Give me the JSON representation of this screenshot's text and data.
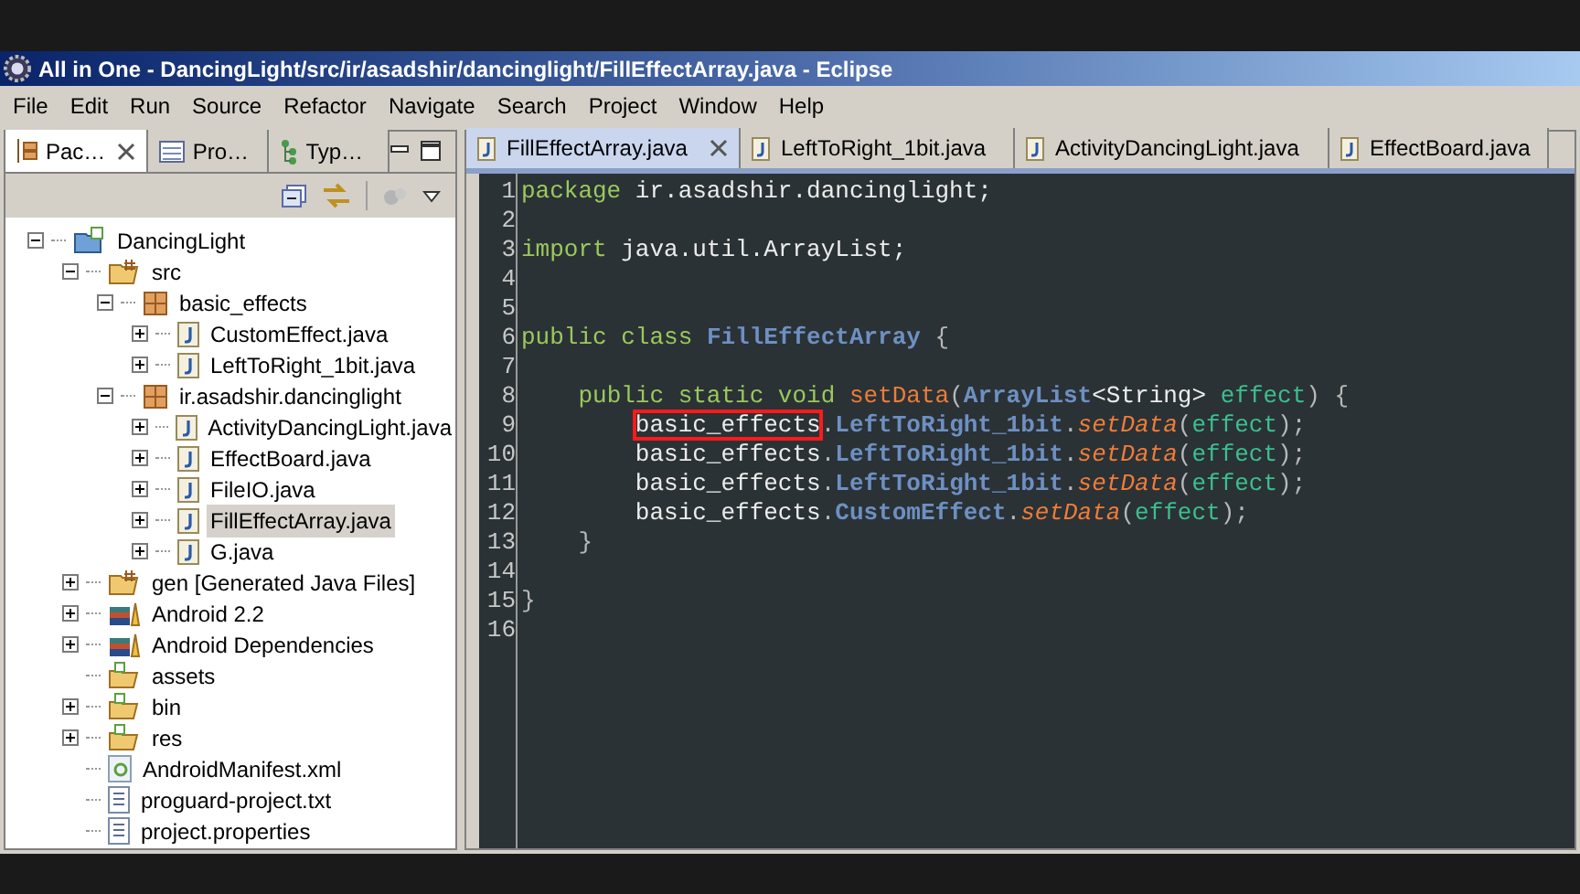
{
  "window": {
    "title": "All in One - DancingLight/src/ir/asadshir/dancinglight/FillEffectArray.java - Eclipse"
  },
  "menu": [
    "File",
    "Edit",
    "Run",
    "Source",
    "Refactor",
    "Navigate",
    "Search",
    "Project",
    "Window",
    "Help"
  ],
  "left_tabs": [
    {
      "label": "Pac…",
      "kind": "package",
      "selected": true
    },
    {
      "label": "Pro…",
      "kind": "problems",
      "selected": false
    },
    {
      "label": "Typ…",
      "kind": "hierarchy",
      "selected": false
    }
  ],
  "tree": [
    {
      "label": "DancingLight",
      "kind": "project",
      "expanded": true,
      "selected": false,
      "children": [
        {
          "label": "src",
          "kind": "srcfolder",
          "expanded": true,
          "selected": false,
          "children": [
            {
              "label": "basic_effects",
              "kind": "package",
              "expanded": true,
              "selected": false,
              "children": [
                {
                  "label": "CustomEffect.java",
                  "kind": "java",
                  "expanded": false,
                  "selected": false
                },
                {
                  "label": "LeftToRight_1bit.java",
                  "kind": "java",
                  "expanded": false,
                  "selected": false
                }
              ]
            },
            {
              "label": "ir.asadshir.dancinglight",
              "kind": "package",
              "expanded": true,
              "selected": false,
              "children": [
                {
                  "label": "ActivityDancingLight.java",
                  "kind": "java",
                  "expanded": false,
                  "selected": false
                },
                {
                  "label": "EffectBoard.java",
                  "kind": "java",
                  "expanded": false,
                  "selected": false
                },
                {
                  "label": "FileIO.java",
                  "kind": "java",
                  "expanded": false,
                  "selected": false
                },
                {
                  "label": "FillEffectArray.java",
                  "kind": "java",
                  "expanded": false,
                  "selected": true
                },
                {
                  "label": "G.java",
                  "kind": "java",
                  "expanded": false,
                  "selected": false
                }
              ]
            }
          ]
        },
        {
          "label": "gen [Generated Java Files]",
          "kind": "genfolder",
          "expanded": false,
          "selected": false
        },
        {
          "label": "Android 2.2",
          "kind": "library",
          "expanded": false,
          "selected": false
        },
        {
          "label": "Android Dependencies",
          "kind": "library",
          "expanded": false,
          "selected": false
        },
        {
          "label": "assets",
          "kind": "folder",
          "selected": false
        },
        {
          "label": "bin",
          "kind": "folder",
          "expanded": false,
          "selected": false
        },
        {
          "label": "res",
          "kind": "folder",
          "expanded": false,
          "selected": false
        },
        {
          "label": "AndroidManifest.xml",
          "kind": "xml",
          "selected": false
        },
        {
          "label": "proguard-project.txt",
          "kind": "text",
          "selected": false
        },
        {
          "label": "project.properties",
          "kind": "text",
          "selected": false
        }
      ]
    }
  ],
  "editor_tabs": [
    {
      "label": "FillEffectArray.java",
      "selected": true
    },
    {
      "label": "LeftToRight_1bit.java",
      "selected": false
    },
    {
      "label": "ActivityDancingLight.java",
      "selected": false
    },
    {
      "label": "EffectBoard.java",
      "selected": false
    }
  ],
  "code": [
    {
      "number": "1",
      "tokens": [
        {
          "text": "package",
          "kind": "keyword"
        },
        {
          "text": " ir.asadshir.dancinglight;",
          "kind": "plain"
        }
      ]
    },
    {
      "number": "2"
    },
    {
      "number": "3",
      "tokens": [
        {
          "text": "import",
          "kind": "keyword"
        },
        {
          "text": " java.util.ArrayList;",
          "kind": "plain"
        }
      ]
    },
    {
      "number": "4"
    },
    {
      "number": "5"
    },
    {
      "number": "6",
      "tokens": [
        {
          "text": "public class",
          "kind": "keyword"
        },
        {
          "text": " FillEffectArray",
          "kind": "type"
        },
        {
          "text": " {",
          "kind": "punct"
        }
      ]
    },
    {
      "number": "7"
    },
    {
      "number": "8",
      "tokens": [
        {
          "text": "    public static void",
          "kind": "keyword"
        },
        {
          "text": " setData",
          "kind": "method"
        },
        {
          "text": "(",
          "kind": "punct"
        },
        {
          "text": "ArrayList",
          "kind": "type"
        },
        {
          "text": "<String>",
          "kind": "plain"
        },
        {
          "text": " effect",
          "kind": "param"
        },
        {
          "text": ") {",
          "kind": "punct"
        }
      ]
    },
    {
      "number": "9",
      "tokens": [
        {
          "text": "        basic_effects",
          "kind": "plain",
          "highlighted": true
        },
        {
          "text": ".",
          "kind": "punct"
        },
        {
          "text": "LeftToRight_1bit",
          "kind": "type"
        },
        {
          "text": ".",
          "kind": "punct"
        },
        {
          "text": "setData",
          "kind": "static_method"
        },
        {
          "text": "(",
          "kind": "punct"
        },
        {
          "text": "effect",
          "kind": "param"
        },
        {
          "text": ");",
          "kind": "punct"
        }
      ]
    },
    {
      "number": "10",
      "tokens": [
        {
          "text": "        basic_effects",
          "kind": "plain"
        },
        {
          "text": ".",
          "kind": "punct"
        },
        {
          "text": "LeftToRight_1bit",
          "kind": "type"
        },
        {
          "text": ".",
          "kind": "punct"
        },
        {
          "text": "setData",
          "kind": "static_method"
        },
        {
          "text": "(",
          "kind": "punct"
        },
        {
          "text": "effect",
          "kind": "param"
        },
        {
          "text": ");",
          "kind": "punct"
        }
      ]
    },
    {
      "number": "11",
      "tokens": [
        {
          "text": "        basic_effects",
          "kind": "plain"
        },
        {
          "text": ".",
          "kind": "punct"
        },
        {
          "text": "LeftToRight_1bit",
          "kind": "type"
        },
        {
          "text": ".",
          "kind": "punct"
        },
        {
          "text": "setData",
          "kind": "static_method"
        },
        {
          "text": "(",
          "kind": "punct"
        },
        {
          "text": "effect",
          "kind": "param"
        },
        {
          "text": ");",
          "kind": "punct"
        }
      ]
    },
    {
      "number": "12",
      "tokens": [
        {
          "text": "        basic_effects",
          "kind": "plain"
        },
        {
          "text": ".",
          "kind": "punct"
        },
        {
          "text": "CustomEffect",
          "kind": "type"
        },
        {
          "text": ".",
          "kind": "punct"
        },
        {
          "text": "setData",
          "kind": "static_method"
        },
        {
          "text": "(",
          "kind": "punct"
        },
        {
          "text": "effect",
          "kind": "param"
        },
        {
          "text": ");",
          "kind": "punct"
        }
      ]
    },
    {
      "number": "13",
      "tokens": [
        {
          "text": "    }",
          "kind": "punct"
        }
      ]
    },
    {
      "number": "14"
    },
    {
      "number": "15",
      "tokens": [
        {
          "text": "}",
          "kind": "punct"
        }
      ]
    },
    {
      "number": "16"
    }
  ]
}
